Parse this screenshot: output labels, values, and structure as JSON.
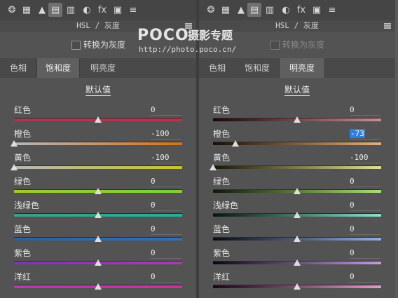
{
  "toolbar_icons": [
    "aperture-icon",
    "grid-icon",
    "mountain-icon",
    "hsl-icon",
    "split-tone-icon",
    "lens-icon",
    "fx-icon",
    "camera-icon",
    "sliders-icon"
  ],
  "header_title": "HSL / 灰度",
  "convert_grayscale_label": "转换为灰度",
  "default_label": "默认值",
  "watermark": {
    "logo": "POCO",
    "cn": "摄影专题",
    "url": "http://photo.poco.cn/"
  },
  "panels": [
    {
      "tabs": [
        "色相",
        "饱和度",
        "明亮度"
      ],
      "active_tab": 1,
      "grayscale_enabled": true,
      "sliders": [
        {
          "label": "红色",
          "value": "0",
          "gradient": [
            "#a23b51",
            "#c42d4c"
          ],
          "level": 0
        },
        {
          "label": "橙色",
          "value": "-100",
          "gradient": [
            "#b6b6b6",
            "#d4731e"
          ],
          "level": -100
        },
        {
          "label": "黄色",
          "value": "-100",
          "gradient": [
            "#b8b8b8",
            "#cbc42a"
          ],
          "level": -100
        },
        {
          "label": "绿色",
          "value": "0",
          "gradient": [
            "#9ccc2c",
            "#7bd03a"
          ],
          "level": 0
        },
        {
          "label": "浅绿色",
          "value": "0",
          "gradient": [
            "#3c9f86",
            "#24b0a0"
          ],
          "level": 0
        },
        {
          "label": "蓝色",
          "value": "0",
          "gradient": [
            "#2d5fa0",
            "#2a72c0"
          ],
          "level": 0
        },
        {
          "label": "紫色",
          "value": "0",
          "gradient": [
            "#7a36b4",
            "#b038b6"
          ],
          "level": 0
        },
        {
          "label": "洋红",
          "value": "0",
          "gradient": [
            "#b83aa8",
            "#d0309c"
          ],
          "level": 0
        }
      ]
    },
    {
      "tabs": [
        "色相",
        "饱和度",
        "明亮度"
      ],
      "active_tab": 2,
      "grayscale_enabled": false,
      "sliders": [
        {
          "label": "红色",
          "value": "0",
          "gradient": [
            "#1a0608",
            "#d08a96"
          ],
          "level": 0
        },
        {
          "label": "橙色",
          "value": "-73",
          "gradient": [
            "#1a0e04",
            "#e6b07a"
          ],
          "level": -73,
          "selected": true
        },
        {
          "label": "黄色",
          "value": "-100",
          "gradient": [
            "#171604",
            "#e4df9a"
          ],
          "level": -100
        },
        {
          "label": "绿色",
          "value": "0",
          "gradient": [
            "#0c1a04",
            "#a8e078"
          ],
          "level": 0
        },
        {
          "label": "浅绿色",
          "value": "0",
          "gradient": [
            "#041612",
            "#8ee0cc"
          ],
          "level": 0
        },
        {
          "label": "蓝色",
          "value": "0",
          "gradient": [
            "#040a18",
            "#8eb2e6"
          ],
          "level": 0
        },
        {
          "label": "紫色",
          "value": "0",
          "gradient": [
            "#0e0418",
            "#c69ae6"
          ],
          "level": 0
        },
        {
          "label": "洋红",
          "value": "0",
          "gradient": [
            "#180414",
            "#e49acc"
          ],
          "level": 0
        }
      ]
    }
  ]
}
